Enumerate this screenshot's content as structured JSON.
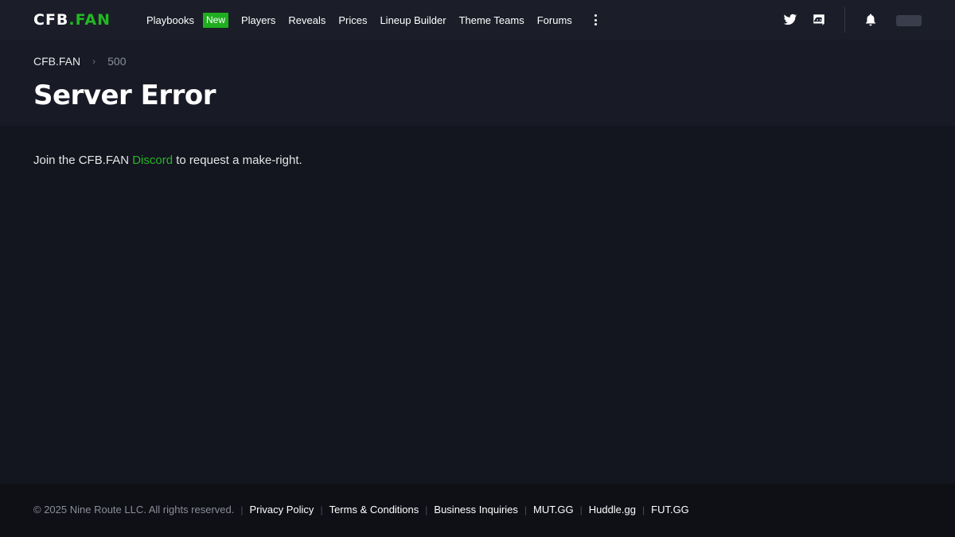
{
  "brand": {
    "logo_left": "CFB",
    "logo_right": ".FAN"
  },
  "nav": {
    "items": [
      {
        "label": "Playbooks",
        "badge": "New"
      },
      {
        "label": "Players"
      },
      {
        "label": "Reveals"
      },
      {
        "label": "Prices"
      },
      {
        "label": "Lineup Builder"
      },
      {
        "label": "Theme Teams"
      },
      {
        "label": "Forums"
      }
    ],
    "more_icon": "kebab-menu-icon"
  },
  "header_icons": [
    "twitter-icon",
    "discord-icon",
    "bell-icon"
  ],
  "breadcrumb": {
    "home": "CFB.FAN",
    "separator": "›",
    "current": "500"
  },
  "page": {
    "title": "Server Error",
    "message_before": "Join the CFB.FAN",
    "message_link": "Discord",
    "message_after": "to request a make-right."
  },
  "footer": {
    "copyright": "© 2025 Nine Route LLC. All rights reserved.",
    "separator": "|",
    "links": [
      "Privacy Policy",
      "Terms & Conditions",
      "Business Inquiries",
      "MUT.GG",
      "Huddle.gg",
      "FUT.GG"
    ]
  },
  "colors": {
    "accent": "#23b823",
    "background": "#13151f",
    "topbar": "#1b1e29",
    "footer": "#0f1016"
  }
}
